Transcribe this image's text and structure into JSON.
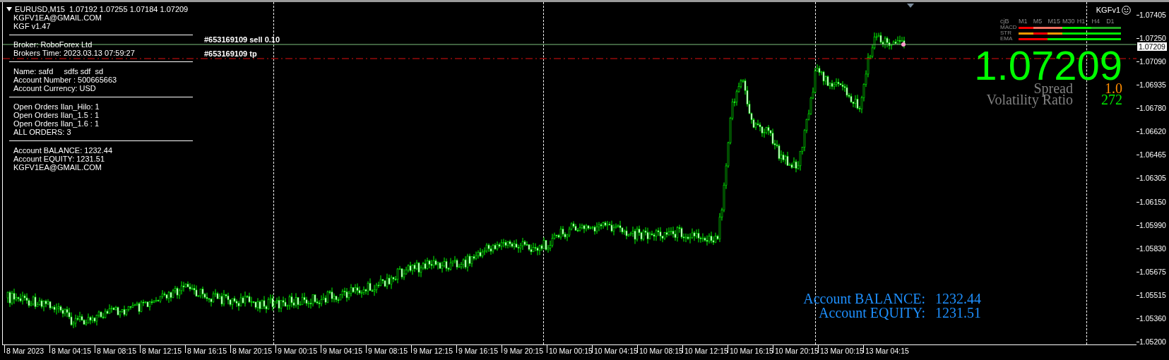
{
  "chart_header": {
    "text": "EURUSD,M15  1.07192 1.07255 1.07184 1.07209"
  },
  "info_panel": {
    "sections": [
      {
        "lines": [
          "KGFV1EA@GMAIL.COM",
          "KGF v1.47"
        ]
      },
      {
        "lines": [
          "Broker: RoboForex Ltd",
          "Brokers Time: 2023.03.13 07:59:27"
        ]
      },
      {
        "lines": [
          "Name: safd     sdfs sdf  sd",
          "Account Number : 500665663",
          "Account Currency: USD"
        ]
      },
      {
        "lines": [
          "Open Orders Ilan_Hilo: 1",
          "Open Orders Ilan_1.5 : 1",
          "Open Orders Ilan_1.6 : 1",
          "ALL ORDERS: 3"
        ]
      },
      {
        "lines": [
          "Account BALANCE: 1232.44",
          "Account EQUITY: 1231.51",
          "KGFV1EA@GMAIL.COM"
        ]
      }
    ]
  },
  "order_lines": [
    {
      "label": "#653169109 sell 0.10",
      "kind": "entry"
    },
    {
      "label": "#653169109 tp",
      "kind": "take_profit"
    }
  ],
  "brand": {
    "text": "KGFv1"
  },
  "trend_table": {
    "header": "cjB",
    "timeframes": [
      "M1",
      "M5",
      "M15",
      "M30",
      "H1",
      "H4",
      "D1"
    ],
    "bars": [
      {
        "cells": [
          {
            "color": "#ff0000"
          },
          {
            "color": "#f07060"
          },
          {
            "color": "#f07060"
          },
          {
            "color": "#00ee00"
          },
          {
            "color": "#00ee00"
          },
          {
            "color": "#22aa22"
          },
          {
            "color": "#22aa22"
          }
        ]
      },
      {
        "cells": [
          {
            "color": "#ff9900"
          },
          {
            "color": "#ff0000"
          },
          {
            "color": "#ff9900"
          },
          {
            "color": "#00ee00"
          },
          {
            "color": "#00ee00"
          },
          {
            "color": "#00ee00"
          },
          {
            "color": "#00ee00"
          }
        ]
      },
      {
        "cells": [
          {
            "color": "#ff0000"
          },
          {
            "color": "#ff0000"
          },
          {
            "color": "#00ee00"
          },
          {
            "color": "#00ee00"
          },
          {
            "color": "#00ee00"
          },
          {
            "color": "#00ee00"
          },
          {
            "color": "#00ee00"
          }
        ]
      }
    ],
    "row_labels": [
      "MACD",
      "STR",
      "EMA"
    ]
  },
  "big_price": "1.07209",
  "stats": [
    {
      "label": "Spread",
      "value": "1.0",
      "color": "#ff8c00"
    },
    {
      "label": "Volatility Ratio",
      "value": "272",
      "color": "#00ee00"
    }
  ],
  "account_summary": [
    {
      "label": "Account BALANCE:",
      "value": "1232.44"
    },
    {
      "label": "Account EQUITY:",
      "value": "1231.51"
    }
  ],
  "price_axis": {
    "labels": [
      "1.07405",
      "1.07250",
      "1.07090",
      "1.06935",
      "1.06780",
      "1.06620",
      "1.06465",
      "1.06305",
      "1.06150",
      "1.05990",
      "1.05830",
      "1.05675",
      "1.05515",
      "1.05360",
      "1.05200"
    ],
    "current_price": "1.07209"
  },
  "time_axis": {
    "labels": [
      "8 Mar 2023",
      "8 Mar 04:15",
      "8 Mar 08:15",
      "8 Mar 12:15",
      "8 Mar 16:15",
      "8 Mar 20:15",
      "9 Mar 00:15",
      "9 Mar 04:15",
      "9 Mar 08:15",
      "9 Mar 12:15",
      "9 Mar 16:15",
      "9 Mar 20:15",
      "10 Mar 00:15",
      "10 Mar 04:15",
      "10 Mar 08:15",
      "10 Mar 12:15",
      "10 Mar 16:15",
      "10 Mar 20:15",
      "13 Mar 00:15",
      "13 Mar 04:15"
    ]
  }
}
